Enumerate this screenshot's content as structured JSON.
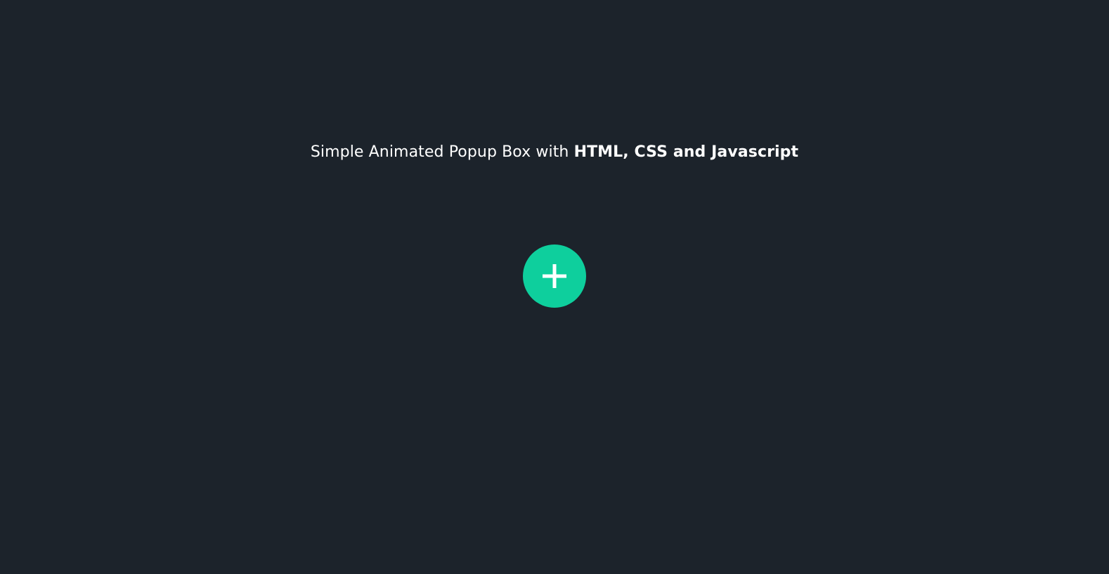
{
  "heading": {
    "text_regular": "Simple Animated Popup Box with ",
    "text_bold": "HTML, CSS and Javascript"
  },
  "add_button": {
    "icon": "plus-icon",
    "color": "#0ecf9d"
  },
  "colors": {
    "background": "#1c232b",
    "text": "#ffffff",
    "accent": "#0ecf9d"
  }
}
